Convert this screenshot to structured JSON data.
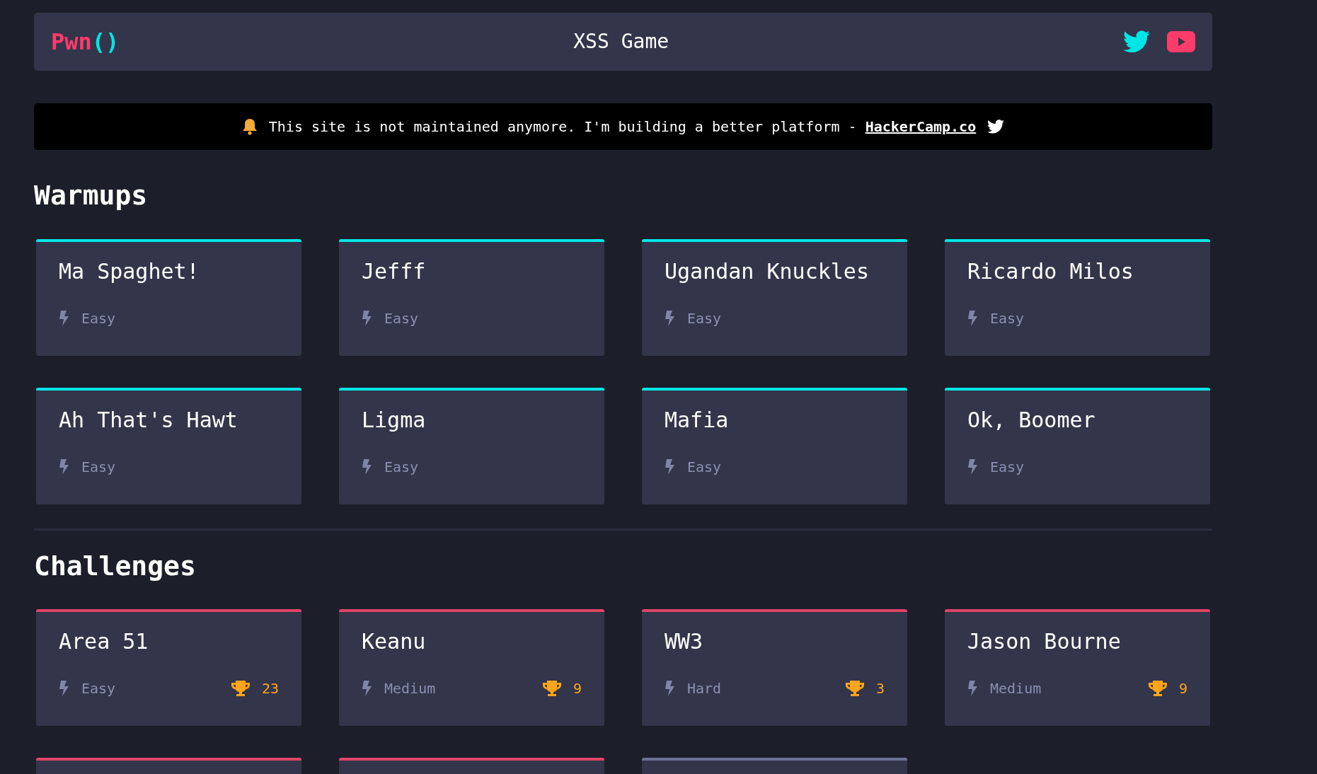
{
  "header": {
    "logo_name": "Pwn",
    "logo_parens": "()",
    "title": "XSS Game"
  },
  "banner": {
    "text": "This site is not maintained anymore. I'm building a better platform - ",
    "link": "HackerCamp.co"
  },
  "sections": [
    {
      "title": "Warmups",
      "cards": [
        {
          "title": "Ma Spaghet!",
          "difficulty": "Easy",
          "color": "#00e5e5"
        },
        {
          "title": "Jefff",
          "difficulty": "Easy",
          "color": "#00e5e5"
        },
        {
          "title": "Ugandan Knuckles",
          "difficulty": "Easy",
          "color": "#00e5e5"
        },
        {
          "title": "Ricardo Milos",
          "difficulty": "Easy",
          "color": "#00e5e5"
        },
        {
          "title": "Ah That's Hawt",
          "difficulty": "Easy",
          "color": "#00e5e5"
        },
        {
          "title": "Ligma",
          "difficulty": "Easy",
          "color": "#00e5e5"
        },
        {
          "title": "Mafia",
          "difficulty": "Easy",
          "color": "#00e5e5"
        },
        {
          "title": "Ok, Boomer",
          "difficulty": "Easy",
          "color": "#00e5e5"
        }
      ]
    },
    {
      "title": "Challenges",
      "cards": [
        {
          "title": "Area 51",
          "difficulty": "Easy",
          "solves": "23",
          "color": "#e04468"
        },
        {
          "title": "Keanu",
          "difficulty": "Medium",
          "solves": "9",
          "color": "#e04468"
        },
        {
          "title": "WW3",
          "difficulty": "Hard",
          "solves": "3",
          "color": "#e04468"
        },
        {
          "title": "Jason Bourne",
          "difficulty": "Medium",
          "solves": "9",
          "color": "#e04468"
        },
        {
          "color": "#e04468"
        },
        {
          "color": "#e04468"
        },
        {
          "color": "#6b7395"
        }
      ]
    }
  ]
}
